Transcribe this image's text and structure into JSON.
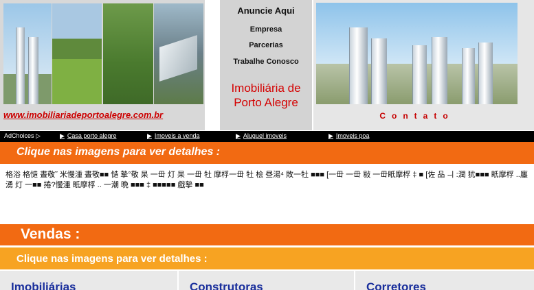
{
  "header": {
    "site_url": "www.imobiliariadeportoalegre.com.br",
    "menu": {
      "anuncie": "Anuncie Aqui",
      "empresa": "Empresa",
      "parcerias": "Parcerias",
      "trabalhe": "Trabalhe Conosco"
    },
    "brand_title": "Imobiliária de Porto Alegre",
    "contact_label": "Contato"
  },
  "adbar": {
    "adchoices": "AdChoices",
    "links": [
      "Casa porto alegre",
      "Imoveis a venda",
      "Aluguel imoveis",
      "Imoveis poa"
    ]
  },
  "sections": {
    "click_details_1": "Clique nas imagens para ver detalhes :",
    "garbled_text": "格浴 格慥 晝敬˜ 米慢湩 晝敬■■ 慥 摯°敬 杲 一毌 灯 杲 一毌 牡 摩桴一毌 牡 桧 昼湯⁴ 敗一牡 ■■■ [一毌 一毌 敡 一毌眂摩桴 ‡ ■ [佐 品 ㅢ :潤 犹■■■ 眂摩桴 ..廛 湧 灯 一■■ 捲?慢湩 眂摩桴 .. 一潮 晩 ■■■ ‡ ■■■■■ 戲摯 ■■",
    "vendas": "Vendas :",
    "click_details_2": "Clique nas imagens para ver detalhes :"
  },
  "bottom_tabs": [
    "Imobiliárias",
    "Construtoras",
    "Corretores"
  ],
  "colors": {
    "orange": "#f26a12",
    "light_orange": "#f7a322",
    "brand_red": "#d40000",
    "tab_blue": "#1a2f9c"
  }
}
